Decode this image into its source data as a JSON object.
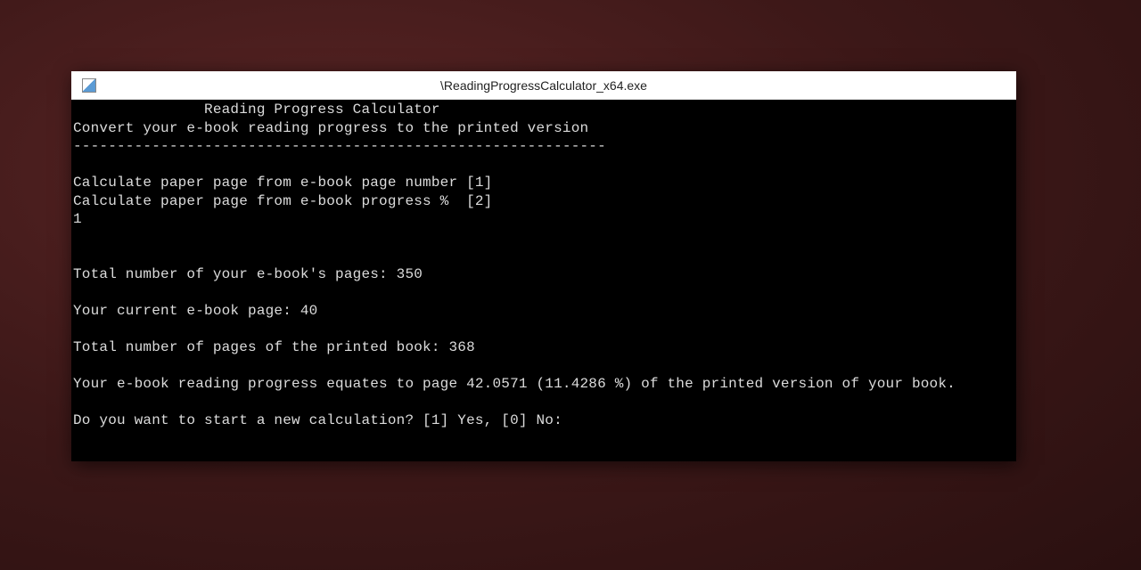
{
  "window": {
    "title": "\\ReadingProgressCalculator_x64.exe"
  },
  "console": {
    "header_title": "               Reading Progress Calculator",
    "subtitle": "Convert your e-book reading progress to the printed version",
    "divider": "-------------------------------------------------------------",
    "blank": " ",
    "option1": "Calculate paper page from e-book page number [1]",
    "option2": "Calculate paper page from e-book progress %  [2]",
    "input_choice": "1",
    "prompt_total_ebook": "Total number of your e-book's pages: 350",
    "prompt_current_page": "Your current e-book page: 40",
    "prompt_total_printed": "Total number of pages of the printed book: 368",
    "result": "Your e-book reading progress equates to page 42.0571 (11.4286 %) of the printed version of your book.",
    "prompt_new_calc": "Do you want to start a new calculation? [1] Yes, [0] No:"
  }
}
